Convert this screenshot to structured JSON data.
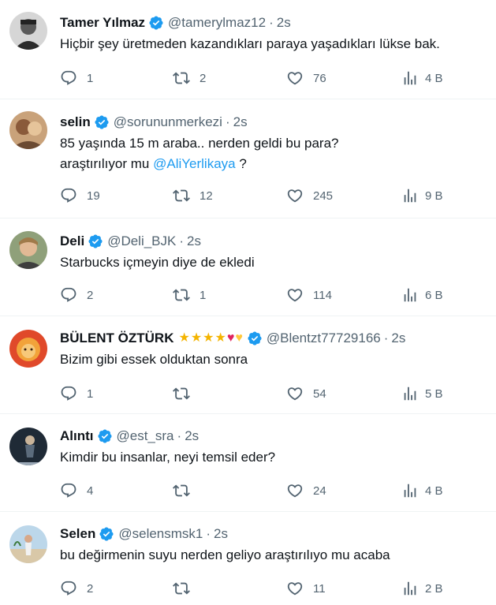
{
  "tweets": [
    {
      "name": "Tamer Yılmaz",
      "emojis": "",
      "handle": "@tamerylmaz12",
      "dot": "·",
      "time": "2s",
      "text_parts": [
        "Hiçbir şey üretmeden kazandıkları paraya yaşadıkları lükse bak."
      ],
      "mention": "",
      "text_after": "",
      "replies": "1",
      "retweets": "2",
      "likes": "76",
      "views": "4 B"
    },
    {
      "name": "selin",
      "emojis": "",
      "handle": "@sorununmerkezi",
      "dot": "·",
      "time": "2s",
      "text_parts": [
        "85 yaşında 15 m araba.. nerden geldi bu para?",
        "araştırılıyor mu "
      ],
      "mention": "@AliYerlikaya",
      "text_after": " ?",
      "replies": "19",
      "retweets": "12",
      "likes": "245",
      "views": "9 B"
    },
    {
      "name": "Deli",
      "emojis": "",
      "handle": "@Deli_BJK",
      "dot": "·",
      "time": "2s",
      "text_parts": [
        "Starbucks içmeyin diye de ekledi"
      ],
      "mention": "",
      "text_after": "",
      "replies": "2",
      "retweets": "1",
      "likes": "114",
      "views": "6 B"
    },
    {
      "name": "BÜLENT ÖZTÜRK",
      "emojis": "★★★★♥♥",
      "handle": "@Blentzt77729166",
      "dot": "·",
      "time": "2s",
      "text_parts": [
        "Bizim gibi essek olduktan sonra"
      ],
      "mention": "",
      "text_after": "",
      "replies": "1",
      "retweets": "",
      "likes": "54",
      "views": "5 B"
    },
    {
      "name": "Alıntı",
      "emojis": "",
      "handle": "@est_sra",
      "dot": "·",
      "time": "2s",
      "text_parts": [
        "Kimdir bu insanlar, neyi temsil eder?"
      ],
      "mention": "",
      "text_after": "",
      "replies": "4",
      "retweets": "",
      "likes": "24",
      "views": "4 B"
    },
    {
      "name": "Selen",
      "emojis": "",
      "handle": "@selensmsk1",
      "dot": "·",
      "time": "2s",
      "text_parts": [
        "bu değirmenin suyu nerden geliyo araştırılıyo mu acaba"
      ],
      "mention": "",
      "text_after": "",
      "replies": "2",
      "retweets": "",
      "likes": "11",
      "views": "2 B"
    }
  ],
  "icons": {
    "reply": "reply-icon",
    "retweet": "retweet-icon",
    "like": "heart-icon",
    "views": "analytics-icon",
    "verified": "verified-badge-icon"
  },
  "colors": {
    "text": "#0f1419",
    "secondary": "#536471",
    "link": "#1d9bf0",
    "divider": "#eff3f4",
    "verified": "#1d9bf0"
  }
}
